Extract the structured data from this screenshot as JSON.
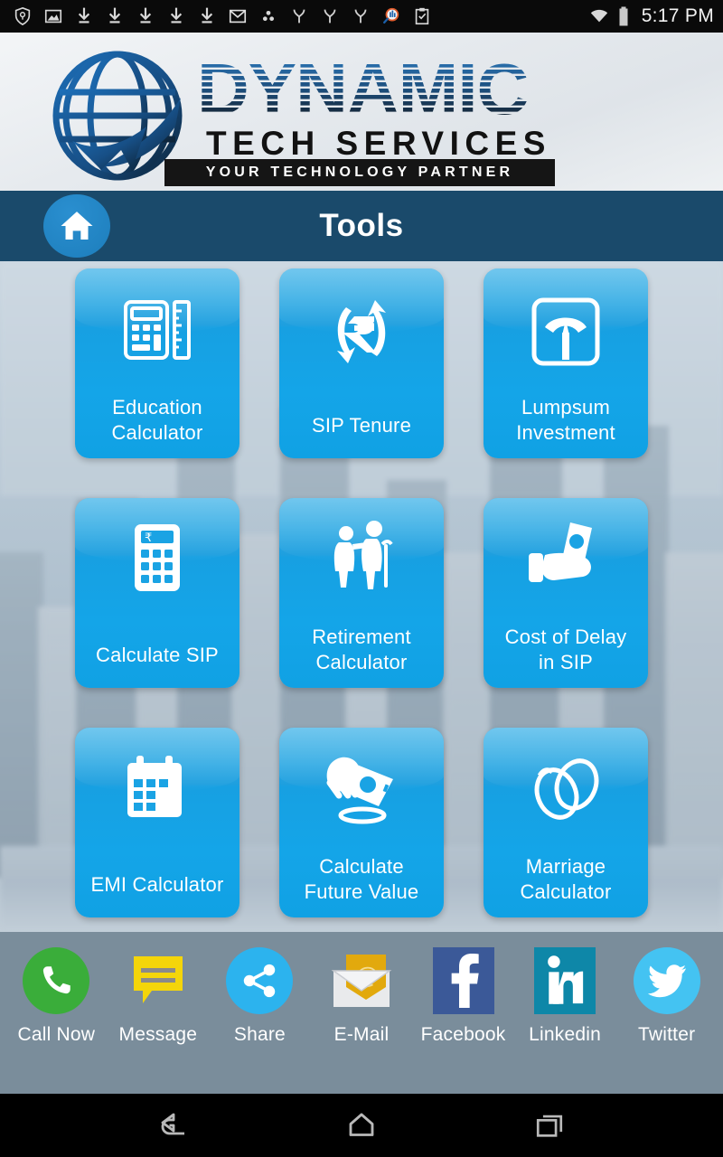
{
  "statusbar": {
    "time": "5:17 PM",
    "left_icons": [
      "shield-key-icon",
      "screenshot-image-icon",
      "download-icon",
      "download-icon",
      "download-icon",
      "download-icon",
      "download-icon",
      "gmail-icon",
      "cluster-dots-icon",
      "wishbone-icon",
      "wishbone-icon",
      "wishbone-icon",
      "analytics-search-icon",
      "clipboard-check-icon"
    ],
    "right_icons": [
      "wifi-icon",
      "battery-icon"
    ]
  },
  "logo": {
    "globe_icon": "globe-arrow-logo-icon",
    "brand": "DYNAMIC",
    "subbrand": "TECH SERVICES",
    "tagline": "YOUR TECHNOLOGY PARTNER"
  },
  "titlebar": {
    "home_icon": "home-icon",
    "title": "Tools",
    "background_color": "#1a4a6b"
  },
  "tools": {
    "accent_color": "#14a5e8",
    "items": [
      {
        "label_line1": "Education",
        "label_line2": "Calculator",
        "icon": "calculator-ruler-icon"
      },
      {
        "label_line1": "SIP Tenure",
        "label_line2": "",
        "icon": "rupee-refresh-icon"
      },
      {
        "label_line1": "Lumpsum",
        "label_line2": "Investment",
        "icon": "weighing-scale-icon"
      },
      {
        "label_line1": "Calculate SIP",
        "label_line2": "",
        "icon": "rupee-calculator-icon"
      },
      {
        "label_line1": "Retirement",
        "label_line2": "Calculator",
        "icon": "elderly-couple-icon"
      },
      {
        "label_line1": "Cost of Delay",
        "label_line2": "in SIP",
        "icon": "hand-holding-cash-icon"
      },
      {
        "label_line1": "EMI Calculator",
        "label_line2": "",
        "icon": "calendar-rupee-icon"
      },
      {
        "label_line1": "Calculate",
        "label_line2": "Future Value",
        "icon": "hand-coin-card-icon"
      },
      {
        "label_line1": "Marriage",
        "label_line2": "Calculator",
        "icon": "wedding-rings-icon"
      }
    ]
  },
  "socialbar": {
    "background_color": "#7a8d9b",
    "items": [
      {
        "label": "Call Now",
        "icon": "phone-icon",
        "color": "#3aad3a"
      },
      {
        "label": "Message",
        "icon": "message-icon",
        "color": "#f4d50a"
      },
      {
        "label": "Share",
        "icon": "share-icon",
        "color": "#2cb3ee"
      },
      {
        "label": "E-Mail",
        "icon": "email-icon",
        "color": "#e2a90d"
      },
      {
        "label": "Facebook",
        "icon": "facebook-icon",
        "color": "#3b5998"
      },
      {
        "label": "Linkedin",
        "icon": "linkedin-icon",
        "color": "#0e87a8"
      },
      {
        "label": "Twitter",
        "icon": "twitter-icon",
        "color": "#44c3f2"
      }
    ]
  },
  "navbar": {
    "back_icon": "back-arrow-icon",
    "home_icon": "home-outline-icon",
    "recents_icon": "recent-apps-icon"
  }
}
